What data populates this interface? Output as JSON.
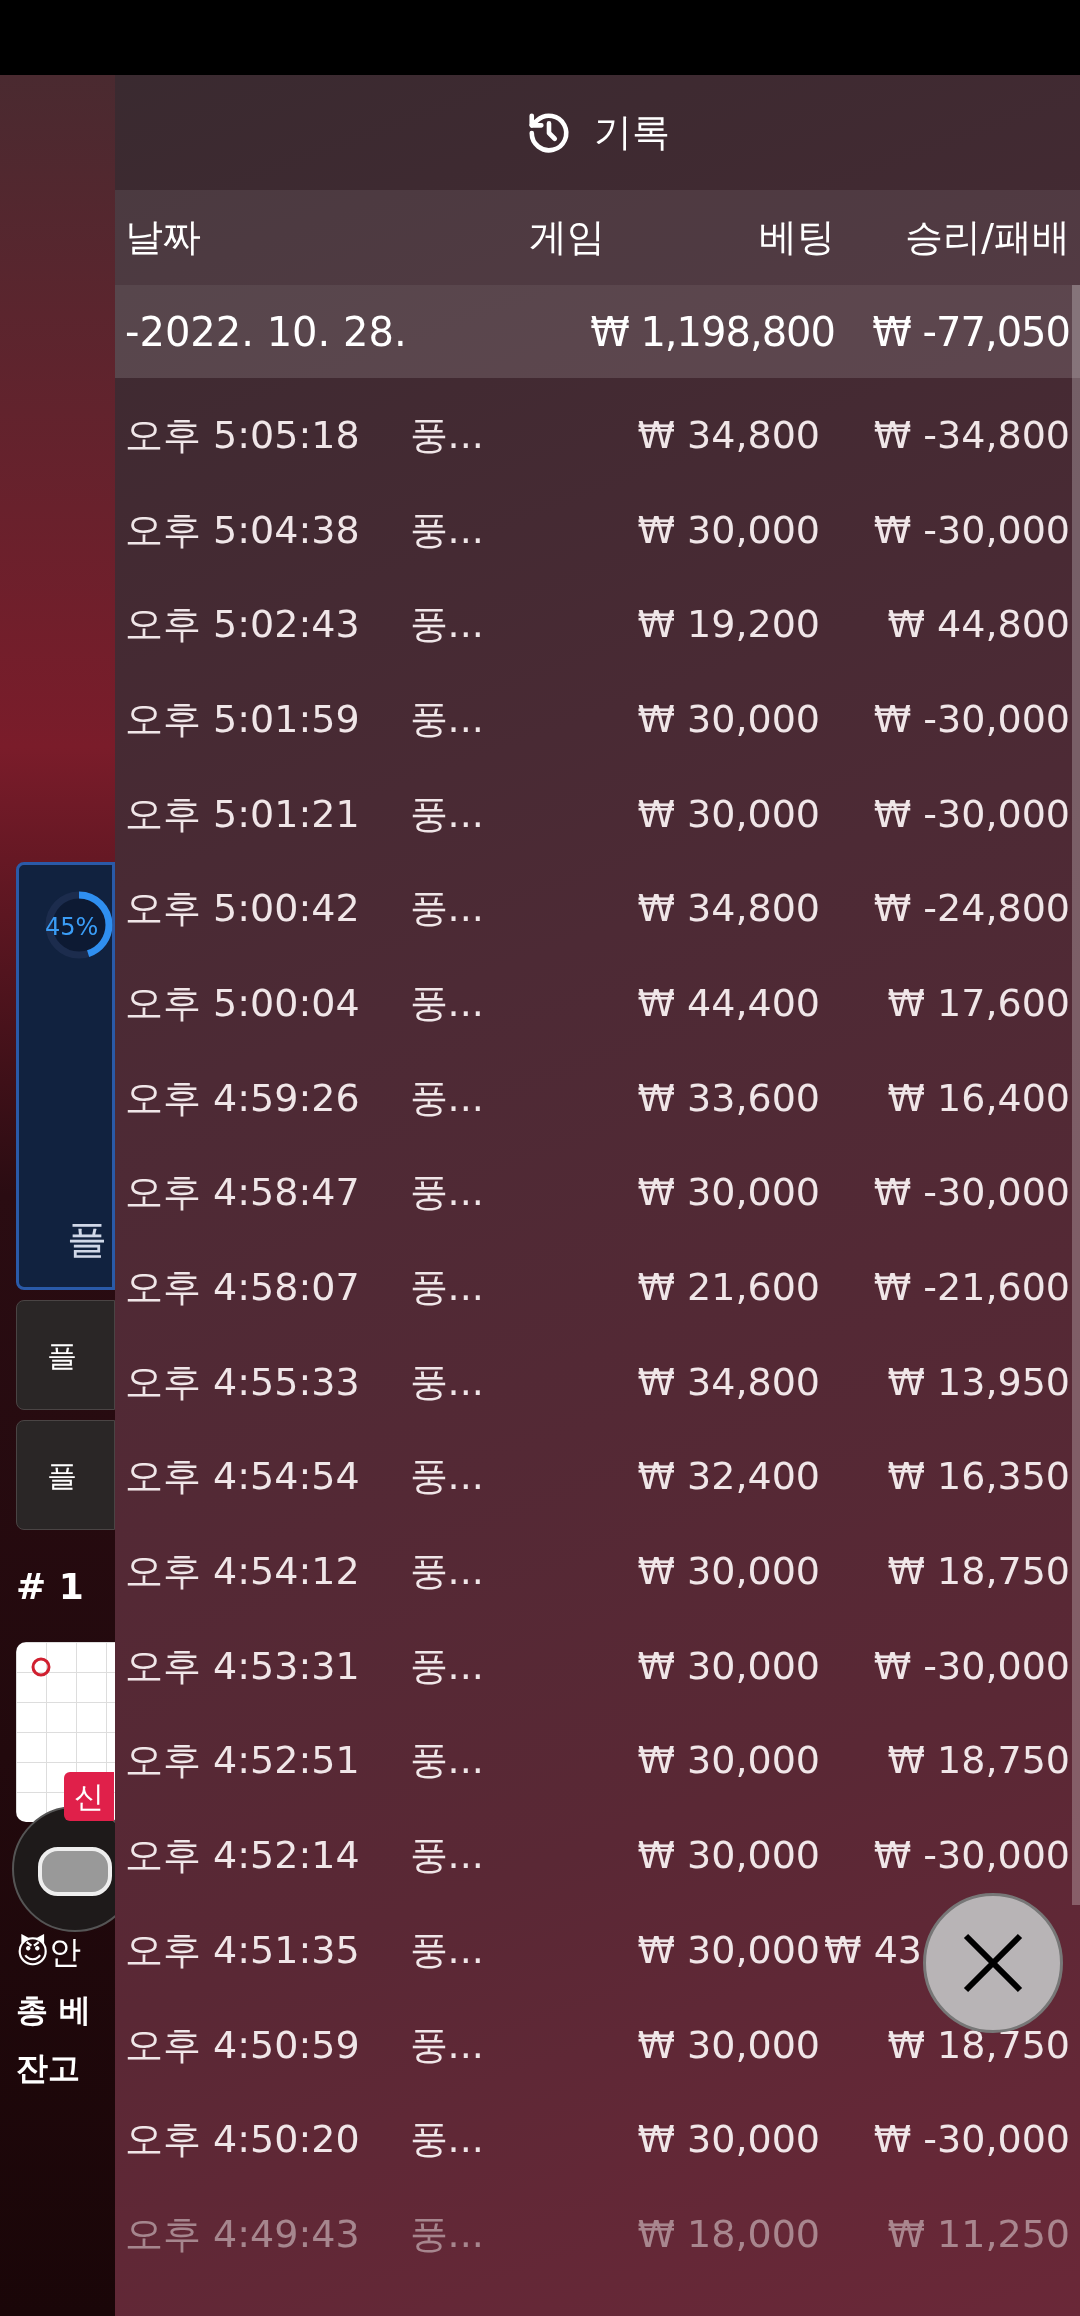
{
  "background": {
    "progress": {
      "label": "45%"
    },
    "buttons": [
      "플",
      "플",
      "플"
    ],
    "rank": "# 1",
    "badge": "신",
    "chat": "😈안",
    "total_bet": "총 베",
    "balance": "잔고"
  },
  "panel": {
    "title": "기록",
    "columns": [
      "날짜",
      "게임",
      "베팅",
      "승리/패배"
    ],
    "summary": {
      "date": "-2022. 10. 28.",
      "bet": "₩ 1,198,800",
      "result": "₩ -77,050"
    },
    "rows": [
      {
        "time": "오후 5:05:18",
        "game": "풍...",
        "bet": "₩ 34,800",
        "result": "₩ -34,800",
        "faded": false
      },
      {
        "time": "오후 5:04:38",
        "game": "풍...",
        "bet": "₩ 30,000",
        "result": "₩ -30,000",
        "faded": false
      },
      {
        "time": "오후 5:02:43",
        "game": "풍...",
        "bet": "₩ 19,200",
        "result": "₩ 44,800",
        "faded": false
      },
      {
        "time": "오후 5:01:59",
        "game": "풍...",
        "bet": "₩ 30,000",
        "result": "₩ -30,000",
        "faded": false
      },
      {
        "time": "오후 5:01:21",
        "game": "풍...",
        "bet": "₩ 30,000",
        "result": "₩ -30,000",
        "faded": false
      },
      {
        "time": "오후 5:00:42",
        "game": "풍...",
        "bet": "₩ 34,800",
        "result": "₩ -24,800",
        "faded": false
      },
      {
        "time": "오후 5:00:04",
        "game": "풍...",
        "bet": "₩ 44,400",
        "result": "₩ 17,600",
        "faded": false
      },
      {
        "time": "오후 4:59:26",
        "game": "풍...",
        "bet": "₩ 33,600",
        "result": "₩ 16,400",
        "faded": false
      },
      {
        "time": "오후 4:58:47",
        "game": "풍...",
        "bet": "₩ 30,000",
        "result": "₩ -30,000",
        "faded": false
      },
      {
        "time": "오후 4:58:07",
        "game": "풍...",
        "bet": "₩ 21,600",
        "result": "₩ -21,600",
        "faded": false
      },
      {
        "time": "오후 4:55:33",
        "game": "풍...",
        "bet": "₩ 34,800",
        "result": "₩ 13,950",
        "faded": false
      },
      {
        "time": "오후 4:54:54",
        "game": "풍...",
        "bet": "₩ 32,400",
        "result": "₩ 16,350",
        "faded": false
      },
      {
        "time": "오후 4:54:12",
        "game": "풍...",
        "bet": "₩ 30,000",
        "result": "₩ 18,750",
        "faded": false
      },
      {
        "time": "오후 4:53:31",
        "game": "풍...",
        "bet": "₩ 30,000",
        "result": "₩ -30,000",
        "faded": false
      },
      {
        "time": "오후 4:52:51",
        "game": "풍...",
        "bet": "₩ 30,000",
        "result": "₩ 18,750",
        "faded": false
      },
      {
        "time": "오후 4:52:14",
        "game": "풍...",
        "bet": "₩ 30,000",
        "result": "₩ -30,000",
        "faded": false
      },
      {
        "time": "오후 4:51:35",
        "game": "풍...",
        "bet": "₩ 30,000",
        "result": "₩ 43",
        "faded": false,
        "partly_hidden": true
      },
      {
        "time": "오후 4:50:59",
        "game": "풍...",
        "bet": "₩ 30,000",
        "result": "₩ 18,750",
        "faded": false
      },
      {
        "time": "오후 4:50:20",
        "game": "풍...",
        "bet": "₩ 30,000",
        "result": "₩ -30,000",
        "faded": false
      },
      {
        "time": "오후 4:49:43",
        "game": "풍...",
        "bet": "₩ 18,000",
        "result": "₩ 11,250",
        "faded": true
      }
    ]
  }
}
